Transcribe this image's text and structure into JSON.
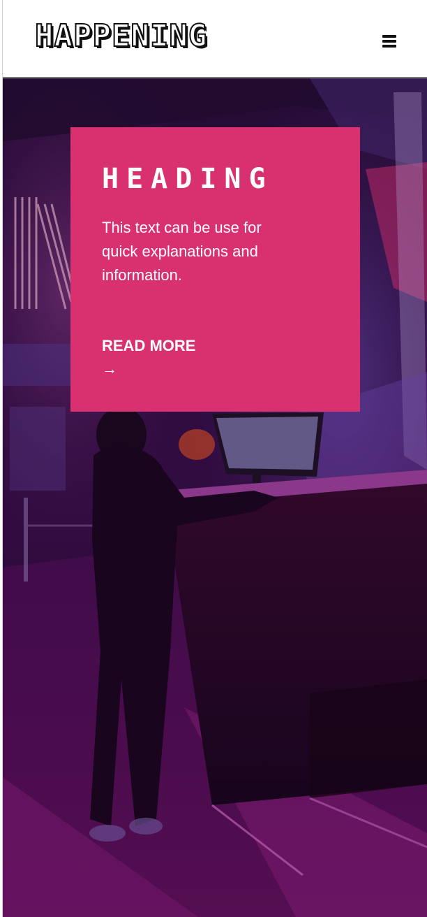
{
  "header": {
    "logo": "HAPPENING",
    "menu_icon": "hamburger-menu-icon"
  },
  "card": {
    "heading": "HEADING",
    "text": "This text can be use for quick explanations and information.",
    "link_label": "READ MORE",
    "link_arrow": "→",
    "link_icon": "arrow-right-icon"
  },
  "colors": {
    "accent": "#d9316f",
    "header_bg": "#ffffff",
    "text_dark": "#111111",
    "hero_tint": "#2a0b3a"
  }
}
